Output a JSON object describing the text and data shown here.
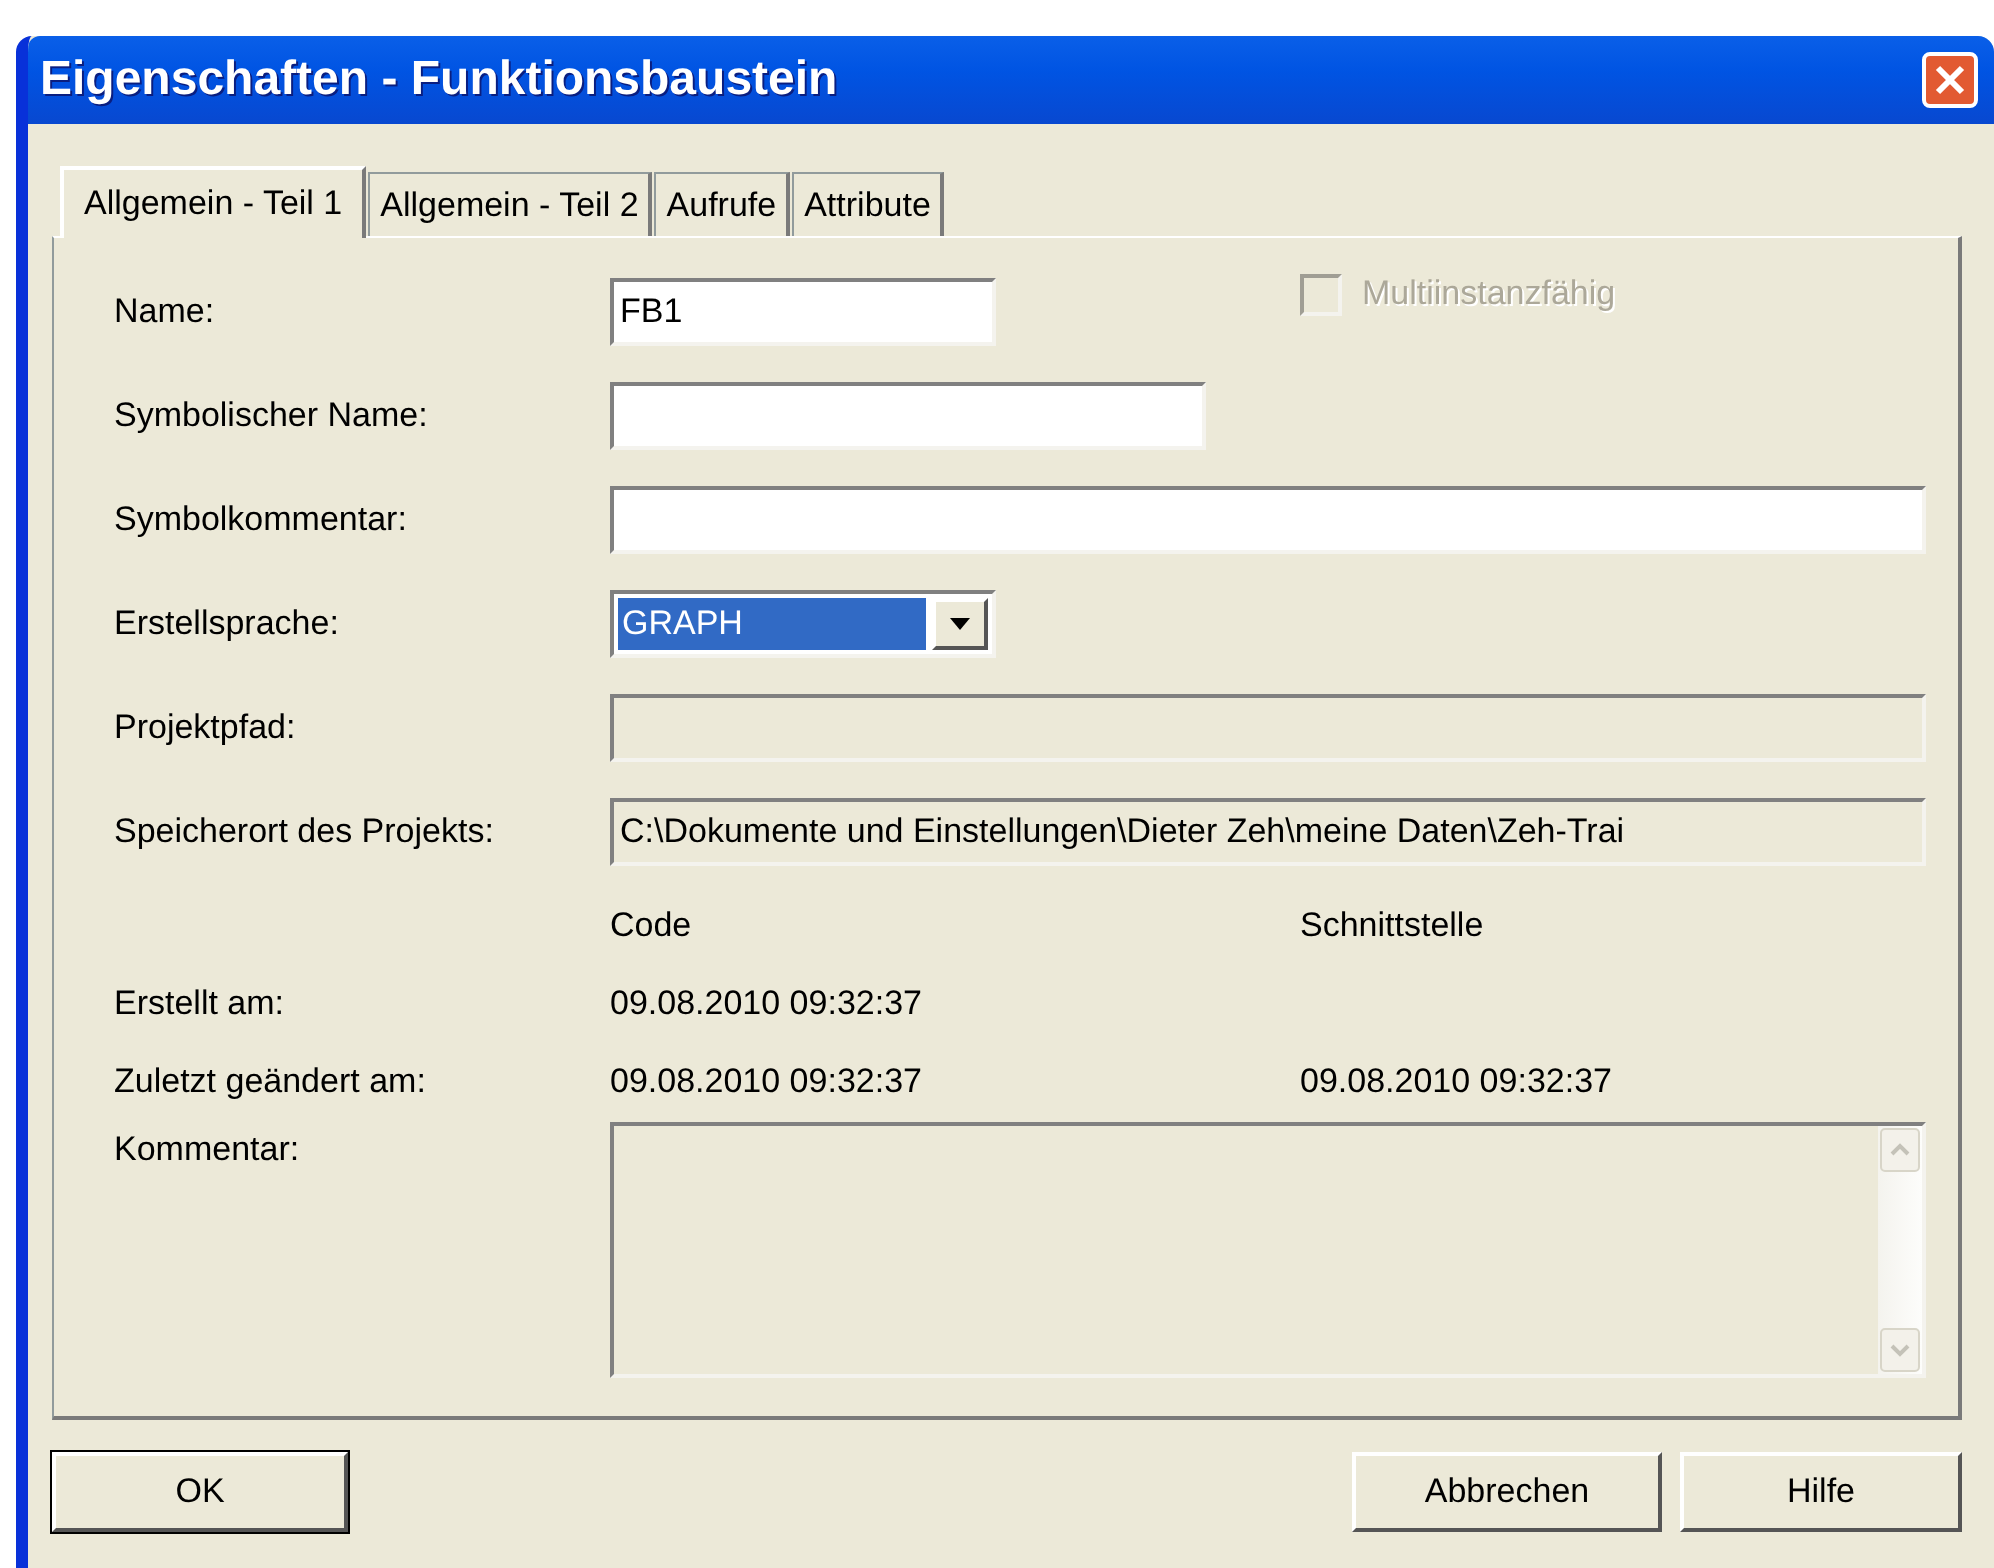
{
  "window": {
    "title": "Eigenschaften - Funktionsbaustein"
  },
  "tabs": [
    {
      "label": "Allgemein - Teil 1",
      "selected": true
    },
    {
      "label": "Allgemein - Teil 2",
      "selected": false
    },
    {
      "label": "Aufrufe",
      "selected": false
    },
    {
      "label": "Attribute",
      "selected": false
    }
  ],
  "fields": [
    {
      "kind": "text",
      "label": "Name:",
      "value": "FB1"
    },
    {
      "kind": "text",
      "label": "Symbolischer Name:"
    },
    {
      "kind": "text",
      "label": "Symbolkommentar:"
    },
    {
      "kind": "combo",
      "label": "Erstellsprache:",
      "value": "GRAPH",
      "focused": true
    },
    {
      "kind": "readonly",
      "label": "Projektpfad:"
    },
    {
      "kind": "readonly",
      "label": "Speicherort des Projekts:",
      "value": "C:\\Dokumente und Einstellungen\\Dieter Zeh\\meine Daten\\Zeh-Trai"
    }
  ],
  "multiinstance": {
    "label": "Multiinstanzfähig",
    "checked": false,
    "disabled": true
  },
  "dates": {
    "columns": [
      "Code",
      "Schnittstelle"
    ],
    "rows": [
      {
        "label": "Erstellt am:",
        "code": "09.08.2010 09:32:37"
      },
      {
        "label": "Zuletzt geändert am:",
        "code": "09.08.2010 09:32:37",
        "interface": "09.08.2010 09:32:37"
      }
    ]
  },
  "comment": {
    "label": "Kommentar:"
  },
  "buttons": [
    {
      "label": "OK",
      "default": true
    },
    {
      "label": "Abbrechen",
      "default": false
    },
    {
      "label": "Hilfe",
      "default": false
    }
  ]
}
